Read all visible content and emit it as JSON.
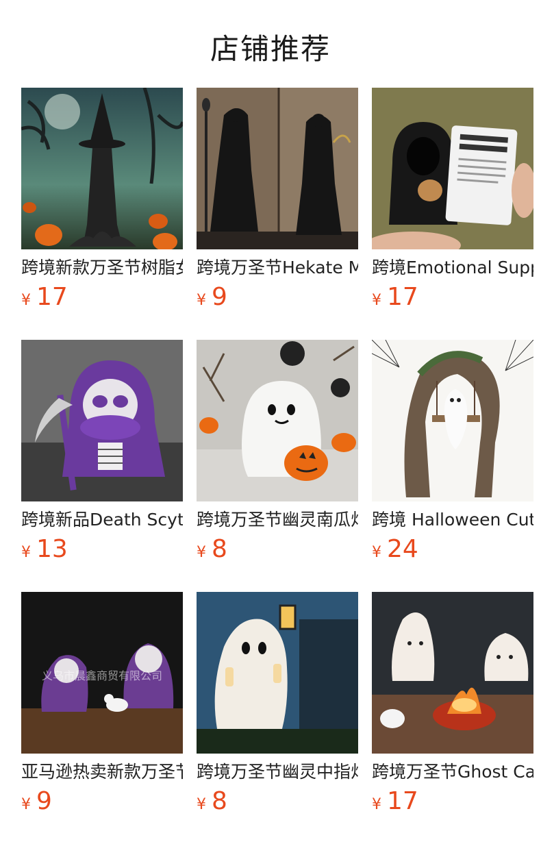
{
  "header": {
    "title": "店铺推荐"
  },
  "currency": "¥",
  "products": [
    {
      "name": "跨境新款万圣节树脂女巫",
      "price": "17",
      "image": "witch-tree-statue"
    },
    {
      "name": "跨境万圣节Hekate Moon",
      "price": "9",
      "image": "hekate-statue"
    },
    {
      "name": "跨境Emotional Support Grim Reaper",
      "price": "17",
      "image": "grim-reaper-figure"
    },
    {
      "name": "跨境新品Death Scythe",
      "price": "13",
      "image": "purple-reaper-duck"
    },
    {
      "name": "跨境万圣节幽灵南瓜灯",
      "price": "8",
      "image": "ghost-pumpkin"
    },
    {
      "name": "跨境 Halloween Cute Ghost",
      "price": "24",
      "image": "ghost-swing-tree"
    },
    {
      "name": "亚马逊热卖新款万圣节",
      "price": "9",
      "image": "purple-reaper-pair"
    },
    {
      "name": "跨境万圣节幽灵中指灯",
      "price": "8",
      "image": "ghost-wall-lamp"
    },
    {
      "name": "跨境万圣节Ghost Campfire",
      "price": "17",
      "image": "ghost-campfire"
    }
  ],
  "watermark": "义乌市晨鑫商贸有限公司"
}
